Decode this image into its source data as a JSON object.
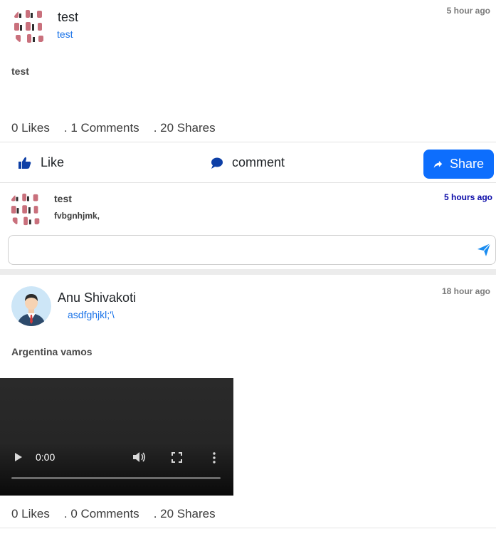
{
  "posts": [
    {
      "author_name": "test",
      "author_subtitle": "test",
      "timestamp": "5 hour ago",
      "text": "test",
      "likes": "0 Likes",
      "comments": ". 1 Comments",
      "shares": ". 20 Shares",
      "actions": {
        "like": "Like",
        "comment": "comment",
        "share": "Share"
      },
      "comment_items": [
        {
          "name": "test",
          "text": "fvbgnhjmk,",
          "time": "5 hours ago"
        }
      ],
      "comment_input_placeholder": ""
    },
    {
      "author_name": "Anu Shivakoti",
      "author_subtitle": "asdfghjkl;'\\",
      "timestamp": "18 hour ago",
      "text": "Argentina vamos",
      "video": {
        "current_time": "0:00",
        "progress": 0
      },
      "likes": "0 Likes",
      "comments": ". 0 Comments",
      "shares": ". 20 Shares"
    }
  ],
  "icons": {
    "like": "thumbs-up-icon",
    "comment": "speech-bubble-icon",
    "share": "share-arrow-icon",
    "send": "paper-plane-icon",
    "play": "play-icon",
    "volume": "volume-icon",
    "fullscreen": "fullscreen-icon",
    "more": "more-vertical-icon"
  },
  "colors": {
    "accent": "#0d6efd",
    "link": "#1a73e8",
    "icon_blue": "#0d3fa6",
    "comment_time": "#0a0aa8"
  }
}
